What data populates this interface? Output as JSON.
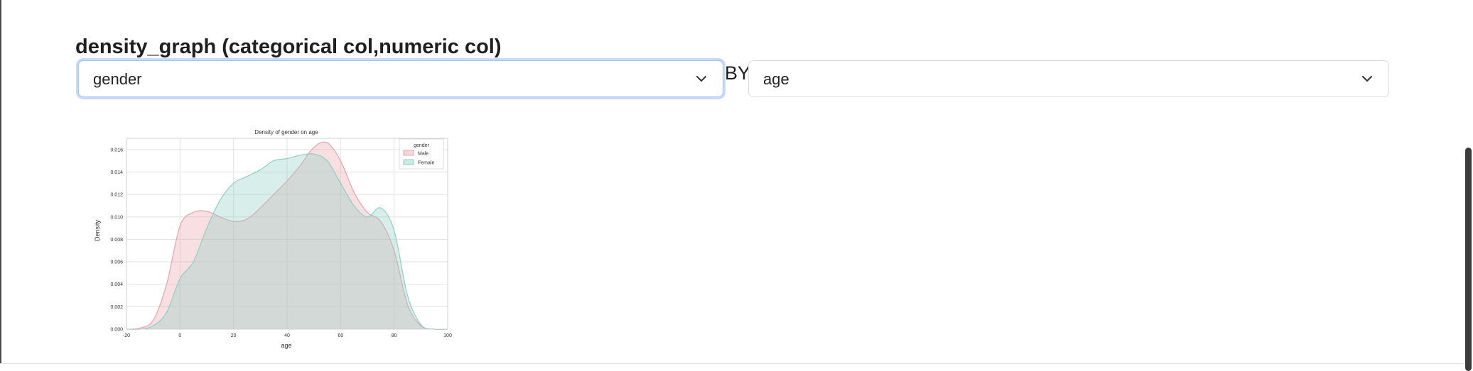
{
  "section": {
    "title": "density_graph (categorical col,numeric col)"
  },
  "controls": {
    "categorical_select": {
      "value": "gender"
    },
    "by_label": "BY",
    "numeric_select": {
      "value": "age"
    }
  },
  "chart_data": {
    "type": "area",
    "title": "Density of gender on age",
    "xlabel": "age",
    "ylabel": "Density",
    "xlim": [
      -20,
      100
    ],
    "ylim": [
      0,
      0.017
    ],
    "x_ticks": [
      -20,
      0,
      20,
      40,
      60,
      80,
      100
    ],
    "y_ticks": [
      0.0,
      0.002,
      0.004,
      0.006,
      0.008,
      0.01,
      0.012,
      0.014,
      0.016
    ],
    "grid": true,
    "legend": {
      "title": "gender",
      "position": "top-right"
    },
    "x": [
      -20,
      -15,
      -10,
      -5,
      0,
      5,
      10,
      15,
      20,
      25,
      30,
      35,
      40,
      45,
      50,
      55,
      60,
      65,
      70,
      75,
      80,
      85,
      90,
      95,
      100
    ],
    "series": [
      {
        "name": "Male",
        "color": "#e8a3ad",
        "values": [
          0,
          0.0001,
          0.0008,
          0.004,
          0.0092,
          0.0104,
          0.0105,
          0.01,
          0.0096,
          0.0098,
          0.0108,
          0.012,
          0.0132,
          0.0146,
          0.0162,
          0.0166,
          0.015,
          0.0122,
          0.0104,
          0.0096,
          0.007,
          0.0022,
          0.0003,
          0,
          0
        ]
      },
      {
        "name": "Female",
        "color": "#8fcfc4",
        "values": [
          0,
          0,
          0.0003,
          0.0015,
          0.0045,
          0.006,
          0.009,
          0.0115,
          0.013,
          0.0136,
          0.0142,
          0.015,
          0.0152,
          0.0155,
          0.0156,
          0.015,
          0.013,
          0.011,
          0.01,
          0.0108,
          0.0088,
          0.003,
          0.0004,
          0,
          0
        ]
      }
    ]
  }
}
